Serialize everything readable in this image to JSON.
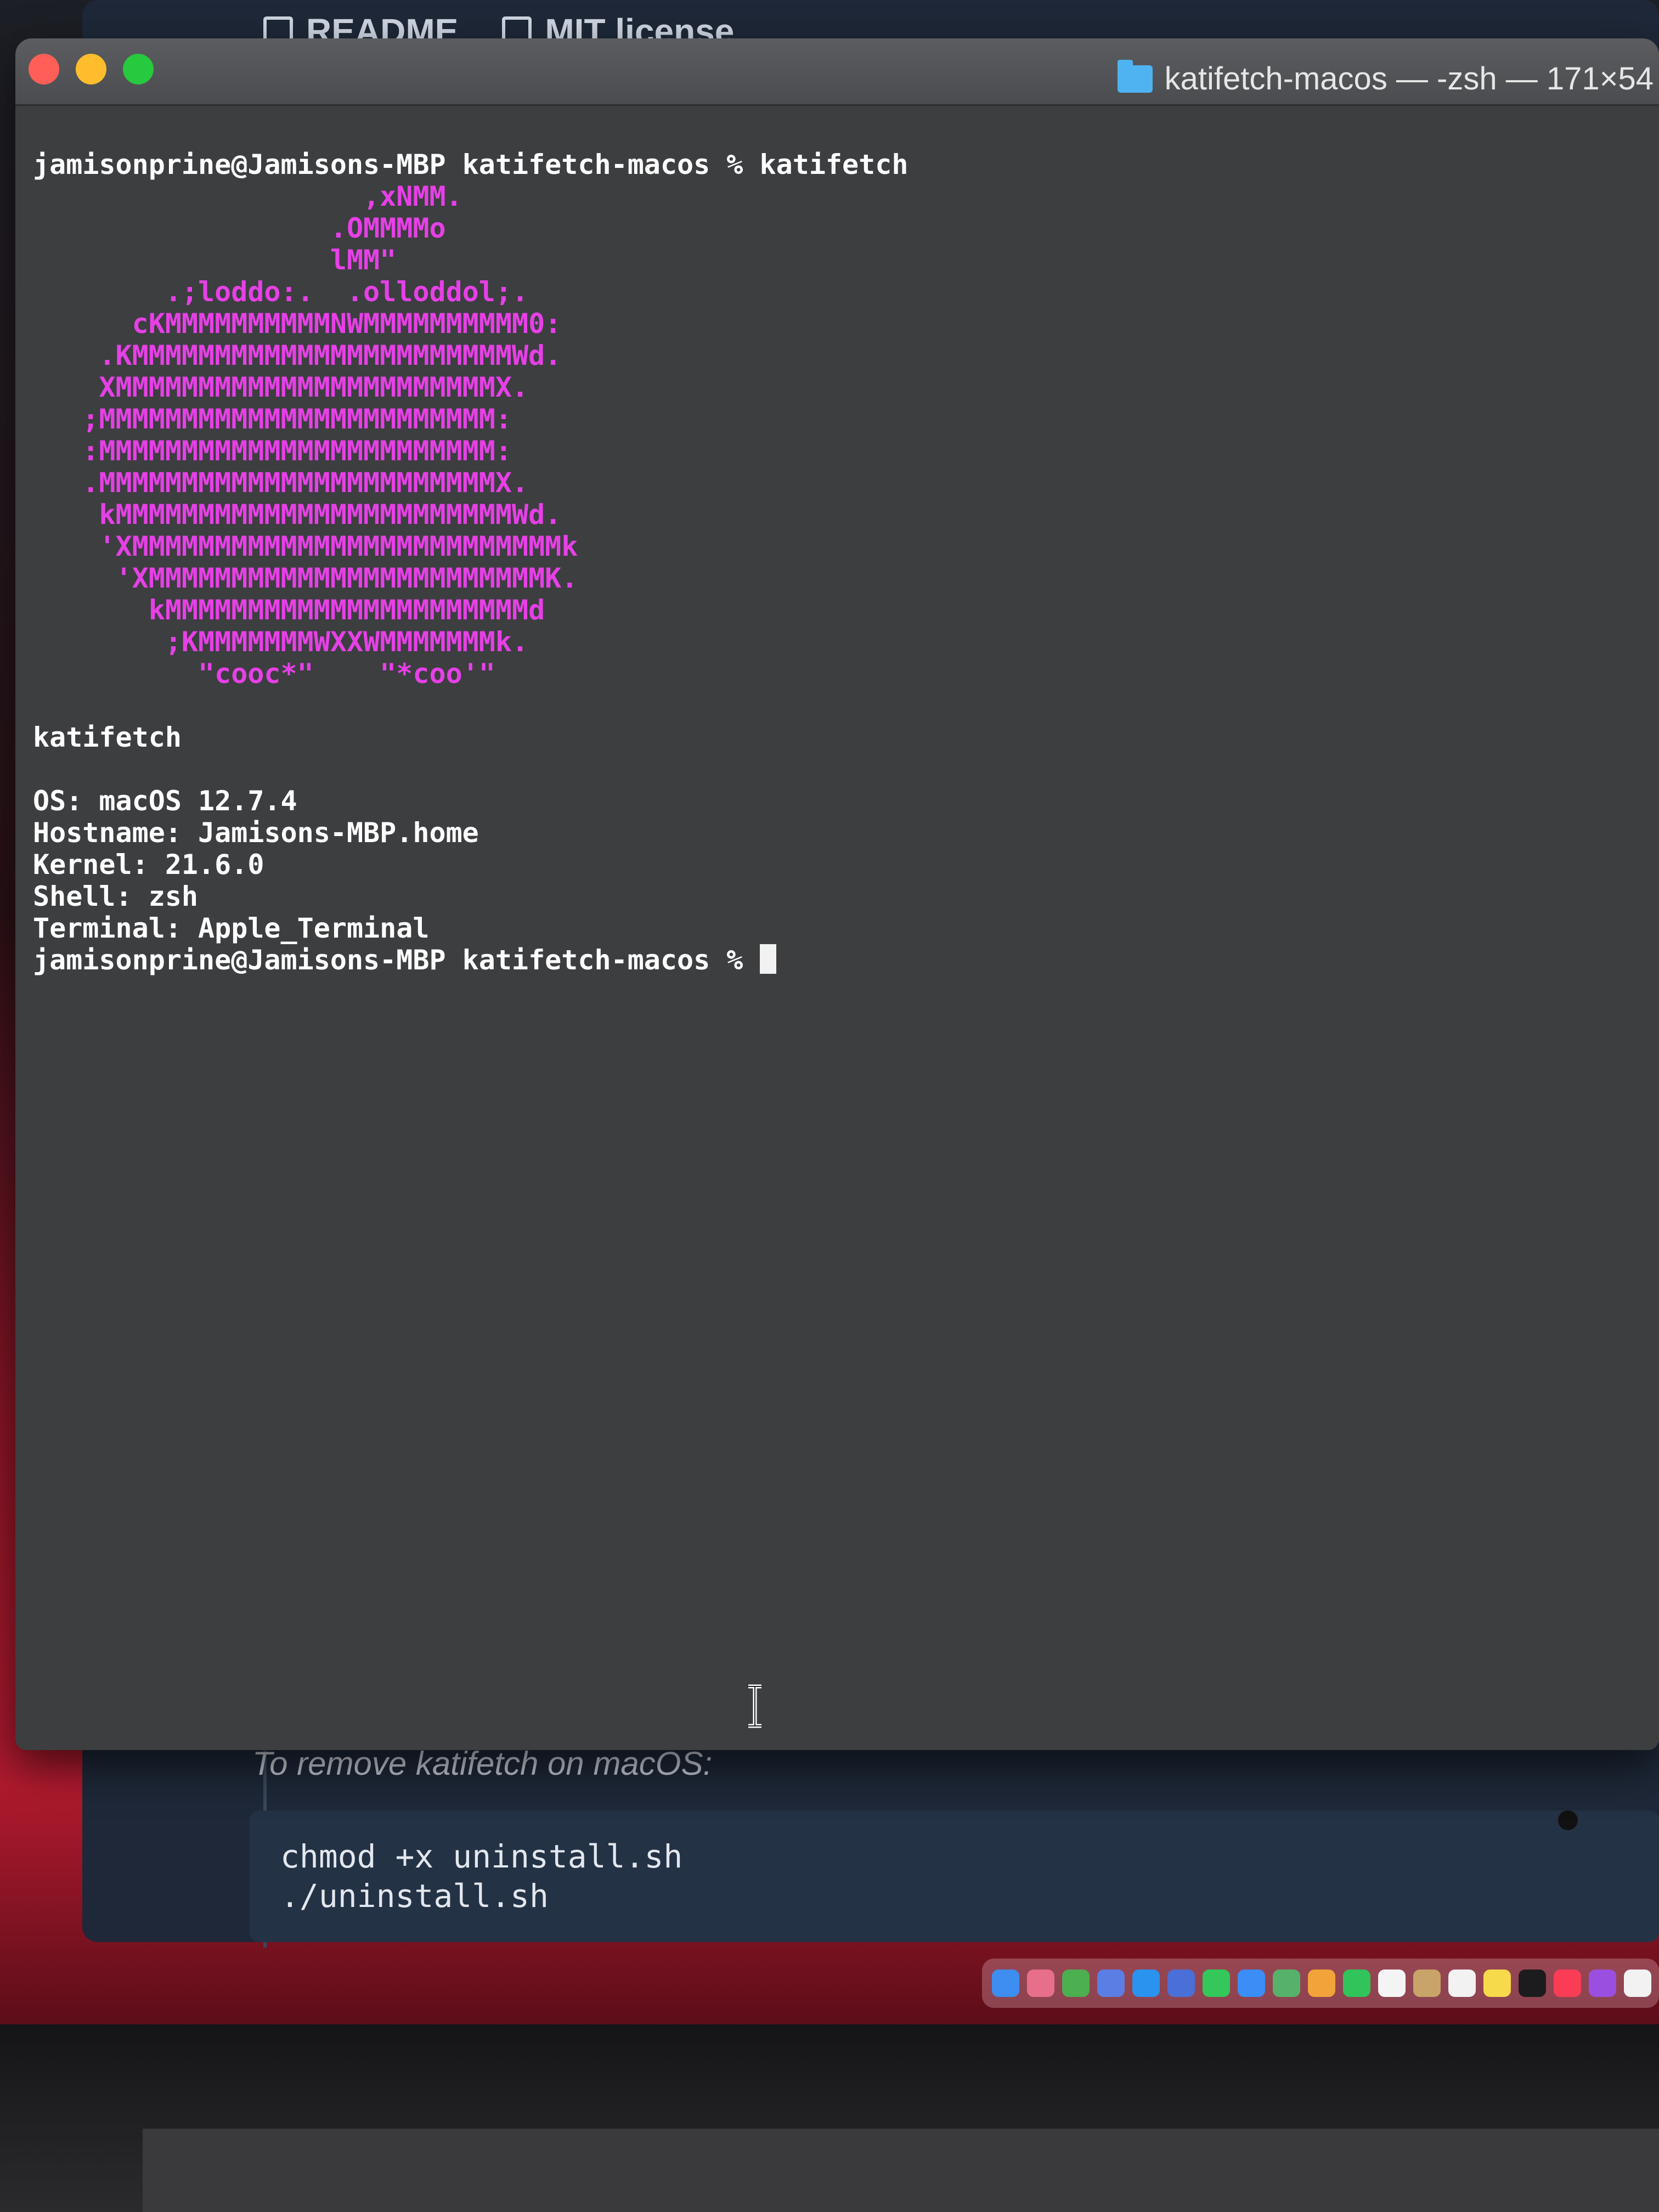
{
  "background_window": {
    "tabs": [
      {
        "label": "README",
        "icon": "book-icon"
      },
      {
        "label": "MIT license",
        "icon": "scale-icon"
      }
    ],
    "fragment_text": "To remove katifetch on macOS:",
    "code_lines": [
      "chmod +x uninstall.sh",
      "./uninstall.sh"
    ]
  },
  "terminal": {
    "window_title": "katifetch-macos — -zsh — 171×54",
    "first_prompt": "jamisonprine@Jamisons-MBP katifetch-macos % katifetch",
    "logo_color": "#e640e6",
    "logo_lines": [
      "                    ,xNMM.",
      "                  .OMMMMo",
      "                  lMM\"",
      "        .;loddo:.  .olloddol;.",
      "      cKMMMMMMMMMMNWMMMMMMMMMM0:",
      "    .KMMMMMMMMMMMMMMMMMMMMMMMWd.",
      "    XMMMMMMMMMMMMMMMMMMMMMMMX.",
      "   ;MMMMMMMMMMMMMMMMMMMMMMMM:",
      "   :MMMMMMMMMMMMMMMMMMMMMMMM:",
      "   .MMMMMMMMMMMMMMMMMMMMMMMMX.",
      "    kMMMMMMMMMMMMMMMMMMMMMMMMWd.",
      "    'XMMMMMMMMMMMMMMMMMMMMMMMMMMk",
      "     'XMMMMMMMMMMMMMMMMMMMMMMMMK.",
      "       kMMMMMMMMMMMMMMMMMMMMMMd",
      "        ;KMMMMMMMWXXWMMMMMMMk.",
      "          \"cooc*\"    \"*coo'\""
    ],
    "info_title": "katifetch",
    "info": [
      "OS: macOS 12.7.4",
      "Hostname: Jamisons-MBP.home",
      "Kernel: 21.6.0",
      "Shell: zsh",
      "Terminal: Apple_Terminal"
    ],
    "final_prompt": "jamisonprine@Jamisons-MBP katifetch-macos % "
  },
  "dock": {
    "icons": [
      {
        "name": "finder-icon",
        "color": "#3d8ef0"
      },
      {
        "name": "launchpad-icon",
        "color": "#e86f8c"
      },
      {
        "name": "minecraft-icon",
        "color": "#4caf50"
      },
      {
        "name": "app-icon",
        "color": "#5b7ee5"
      },
      {
        "name": "safari-icon",
        "color": "#2a93f0"
      },
      {
        "name": "app-icon",
        "color": "#4a6fd6"
      },
      {
        "name": "messages-icon",
        "color": "#34c759"
      },
      {
        "name": "mail-icon",
        "color": "#3a8ef6"
      },
      {
        "name": "maps-icon",
        "color": "#56b26a"
      },
      {
        "name": "photos-icon",
        "color": "#f2a33a"
      },
      {
        "name": "facetime-icon",
        "color": "#31c45a"
      },
      {
        "name": "calendar-icon",
        "color": "#f4f4f4"
      },
      {
        "name": "contacts-icon",
        "color": "#c8a46a"
      },
      {
        "name": "reminders-icon",
        "color": "#f2f2f2"
      },
      {
        "name": "notes-icon",
        "color": "#f7d94c"
      },
      {
        "name": "tv-icon",
        "color": "#1c1c1e"
      },
      {
        "name": "music-icon",
        "color": "#fa3c55"
      },
      {
        "name": "podcasts-icon",
        "color": "#9b4fe0"
      },
      {
        "name": "news-icon",
        "color": "#f2f2f2"
      }
    ]
  }
}
